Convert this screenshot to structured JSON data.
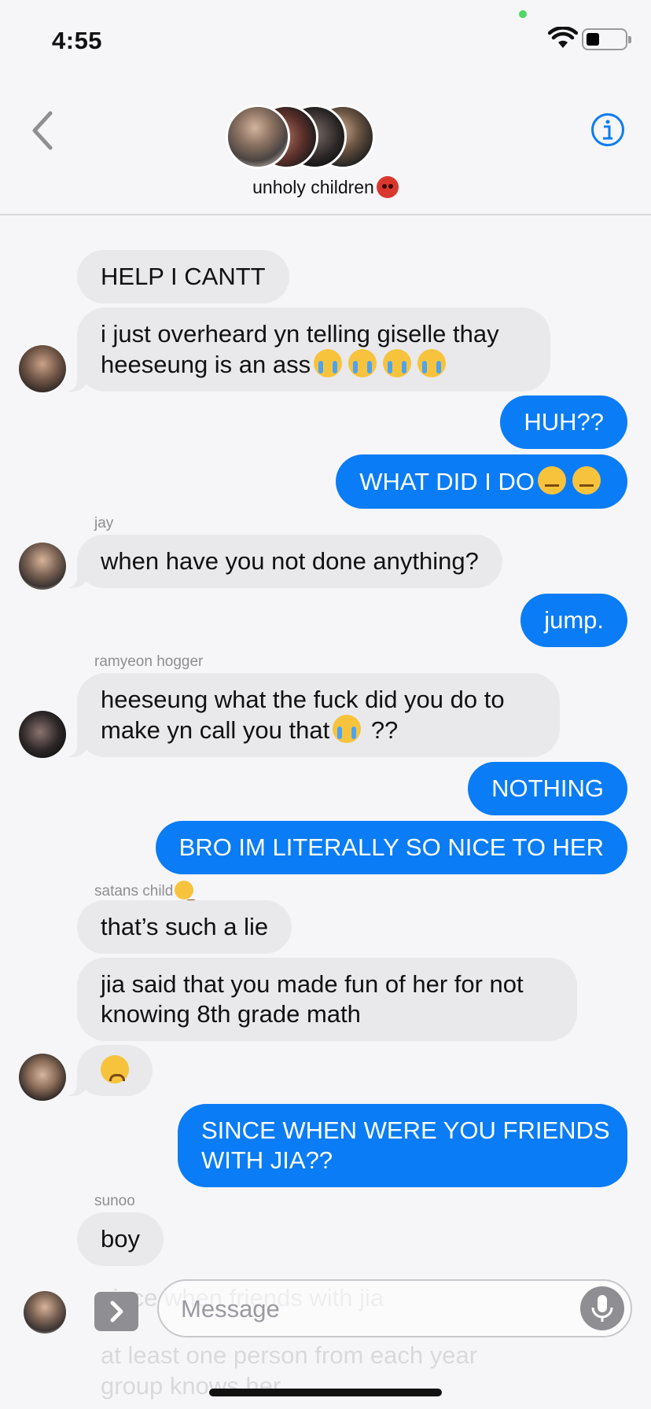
{
  "status_bar": {
    "time": "4:55",
    "battery_level": 0.35
  },
  "header": {
    "group_name": "unholy children",
    "icons": [
      "back-chevron-icon",
      "info-icon"
    ]
  },
  "colors": {
    "outgoing_bubble": "#0a7cf5",
    "incoming_bubble": "#e9e9eb",
    "accent": "#0a7cf5"
  },
  "messages": [
    {
      "dir": "in",
      "text": "HELP I CANTT"
    },
    {
      "dir": "in",
      "line1": "i just overheard yn telling giselle thay",
      "line2": "heeseung is an ass"
    },
    {
      "dir": "out",
      "text": "HUH??"
    },
    {
      "dir": "out",
      "text": "WHAT DID I DO"
    },
    {
      "dir": "in",
      "sender": "jay",
      "text": "when have you not done anything?"
    },
    {
      "dir": "out",
      "text": "jump."
    },
    {
      "dir": "in",
      "sender": "ramyeon hogger",
      "line1": "heeseung what the fuck did you do to",
      "line2a": "make yn call you that",
      "line2b": " ??"
    },
    {
      "dir": "out",
      "text": "NOTHING"
    },
    {
      "dir": "out",
      "text": "BRO IM LITERALLY SO NICE TO HER"
    },
    {
      "dir": "in",
      "sender": "satans child",
      "text": "that’s such a lie"
    },
    {
      "dir": "in",
      "line1": "jia said that you made fun of her for not",
      "line2": "knowing 8th grade math"
    },
    {
      "dir": "in",
      "emoji": "worried-face"
    },
    {
      "dir": "out",
      "line1": "SINCE WHEN WERE YOU FRIENDS",
      "line2": "WITH JIA??"
    },
    {
      "dir": "in",
      "sender": "sunoo",
      "text": "boy"
    }
  ],
  "ghost_messages": [
    "since when friends with jia",
    "at least one person from each year",
    "group knows her"
  ],
  "composer": {
    "placeholder": "Message"
  }
}
